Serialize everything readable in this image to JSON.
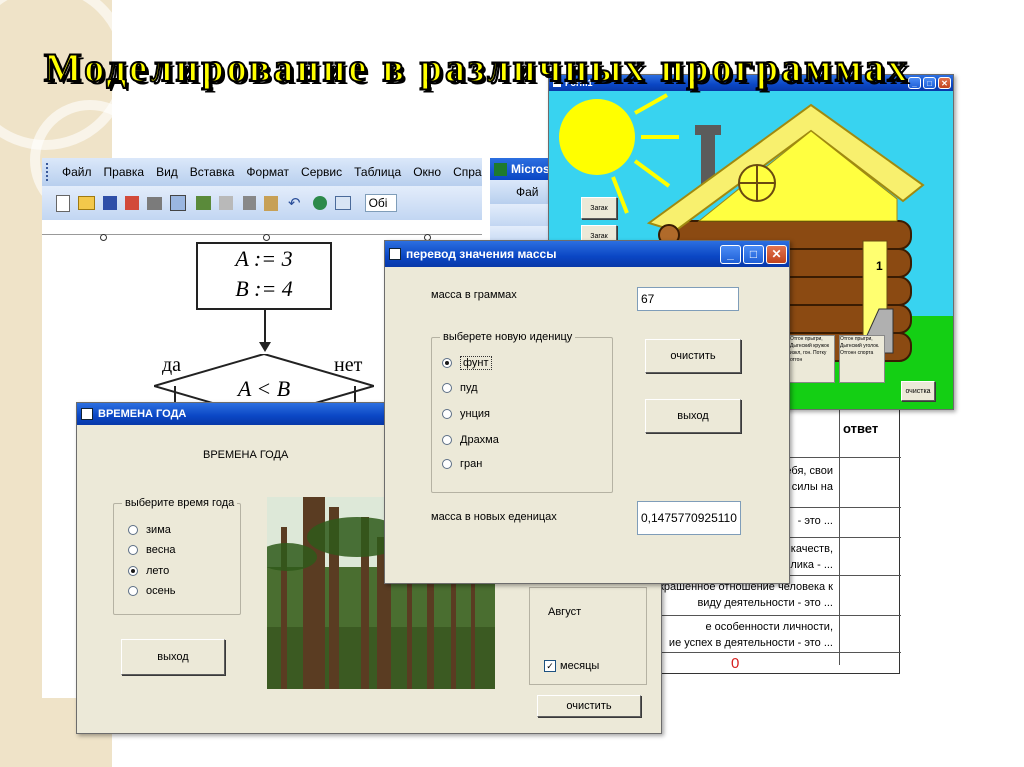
{
  "slide": {
    "title": "Моделирование в различных программах"
  },
  "word_window": {
    "menu": [
      "Файл",
      "Правка",
      "Вид",
      "Вставка",
      "Формат",
      "Сервис",
      "Таблица",
      "Окно",
      "Спра"
    ],
    "style_box": "Обі",
    "flowchart": {
      "line1": "A := 3",
      "line2": "B := 4",
      "yes": "да",
      "no": "нет",
      "condition": "A < B"
    }
  },
  "excel_window": {
    "title": "Microso",
    "menu_first": "Фай",
    "table": {
      "header_answer": "ответ",
      "rows": [
        [
          "ебя, свои",
          "силы на"
        ],
        [
          "- это ..."
        ],
        [
          "качеств,",
          "лика - ..."
        ],
        [
          "окрашенное отношение человека к",
          "виду деятельности - это ..."
        ],
        [
          "е особенности личности,",
          "ие успех в деятельности - это ..."
        ]
      ],
      "total": "0"
    }
  },
  "house_window": {
    "title": "Form1",
    "btn1": "Загак",
    "btn2": "Загак",
    "door_label": "1",
    "notes": [
      "Отгон прыгри, Дыгнский кружок изкл, гон. Потку отгон",
      "Отгон прыгри, Дыгнский уголок. Отгонн спорта"
    ],
    "clear_btn": "очистка"
  },
  "mass_window": {
    "title": "перевод значения массы",
    "grams_label": "масса в граммах",
    "grams_value": "67",
    "group_label": "выберете новую иденицу",
    "units": [
      "фунт",
      "пуд",
      "унция",
      "Драхма",
      "гран"
    ],
    "selected": "фунт",
    "clear_btn": "очистить",
    "exit_btn": "выход",
    "result_label": "масса в новых еденицах",
    "result_value": "0,1475770925110"
  },
  "seasons_window": {
    "title": "ВРЕМЕНА ГОДА",
    "heading": "ВРЕМЕНА ГОДА",
    "group_label": "выберите время года",
    "seasons": [
      "зима",
      "весна",
      "лето",
      "осень"
    ],
    "selected": "лето",
    "exit_btn": "выход",
    "month_label": "Август",
    "months_checkbox": "месяцы",
    "clear_btn": "очистить"
  },
  "colors": {
    "title_fill": "#ffff00",
    "xp_title": "#0a46c4",
    "sky": "#38d3f0",
    "grass": "#14cf14",
    "log": "#8b4a12",
    "roof": "#f8f06e"
  }
}
